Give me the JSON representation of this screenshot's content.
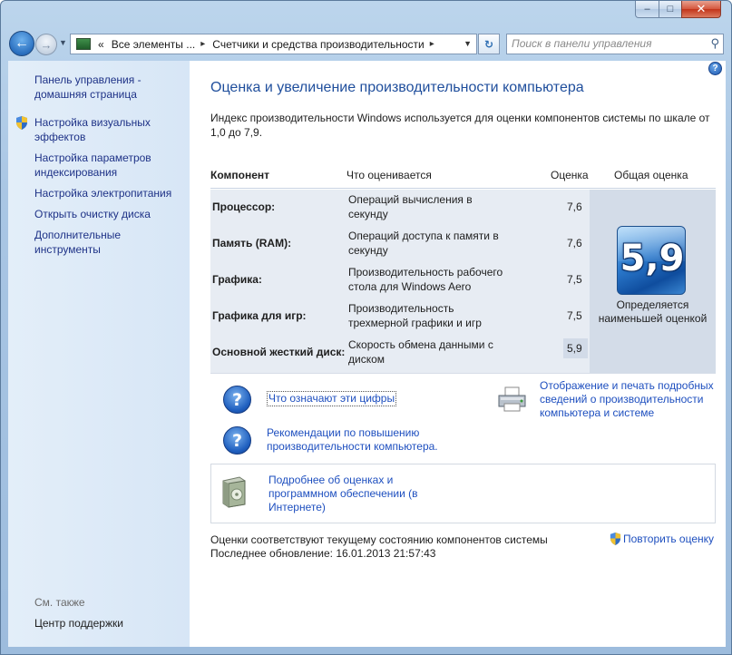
{
  "window": {
    "minimize_glyph": "–",
    "maximize_glyph": "□",
    "close_glyph": "✕"
  },
  "nav": {
    "back_glyph": "←",
    "forward_glyph": "→",
    "address": {
      "prefix": "«",
      "segments": [
        "Все элементы ...",
        "Счетчики и средства производительности"
      ],
      "separator": "▸"
    },
    "search_placeholder": "Поиск в панели управления"
  },
  "sidebar": {
    "home_link": "Панель управления - домашняя страница",
    "tasks": [
      {
        "label": "Настройка визуальных эффектов",
        "icon": "uac-shield-icon"
      },
      {
        "label": "Настройка параметров индексирования",
        "icon": ""
      },
      {
        "label": "Настройка электропитания",
        "icon": ""
      },
      {
        "label": "Открыть очистку диска",
        "icon": ""
      },
      {
        "label": "Дополнительные инструменты",
        "icon": ""
      }
    ],
    "see_also": "См. также",
    "support_link": "Центр поддержки"
  },
  "main": {
    "help_glyph": "?",
    "title": "Оценка и увеличение производительности компьютера",
    "intro": "Индекс производительности Windows используется для оценки компонентов системы по шкале от 1,0 до 7,9.",
    "table": {
      "headers": {
        "component": "Компонент",
        "what": "Что оценивается",
        "score": "Оценка",
        "overall": "Общая оценка"
      },
      "rows": [
        {
          "component": "Процессор:",
          "what": "Операций вычисления в секунду",
          "score": "7,6"
        },
        {
          "component": "Память (RAM):",
          "what": "Операций доступа к памяти в секунду",
          "score": "7,6"
        },
        {
          "component": "Графика:",
          "what": "Производительность рабочего стола для Windows Aero",
          "score": "7,5"
        },
        {
          "component": "Графика для игр:",
          "what": "Производительность трехмерной графики и игр",
          "score": "7,5"
        },
        {
          "component": "Основной жесткий диск:",
          "what": "Скорость обмена данными с диском",
          "score": "5,9"
        }
      ],
      "overall_score": "5,9",
      "overall_caption": "Определяется наименьшей оценкой"
    },
    "links": {
      "what_numbers": "Что означают эти цифры",
      "recommendations": "Рекомендации по повышению производительности компьютера.",
      "print_details": "Отображение и печать подробных сведений о производительности компьютера и системе",
      "learn_more": "Подробнее об оценках и программном обеспечении (в Интернете)"
    },
    "footer": {
      "status": "Оценки соответствуют текущему состоянию компонентов системы",
      "last_update": "Последнее обновление: 16.01.2013 21:57:43"
    },
    "rerun_label": "Повторить оценку"
  },
  "colors": {
    "link": "#1e4fbf",
    "title": "#1f4e9c",
    "sidebar_link": "#1e3287",
    "table_bg": "#e7ecf3",
    "overall_bg": "#d3dce8"
  }
}
